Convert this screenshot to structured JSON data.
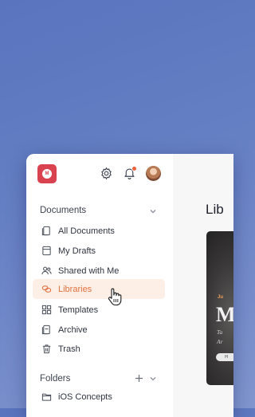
{
  "colors": {
    "accent": "#e2713f",
    "active_bg": "#fdeee6",
    "logo": "#d9434f",
    "notification_dot": "#f0623c"
  },
  "header": {
    "logo_mark": "M",
    "icons": [
      "gear-icon",
      "bell-icon",
      "avatar"
    ]
  },
  "documents_section": {
    "title": "Documents",
    "items": [
      {
        "label": "All Documents",
        "icon": "documents-icon"
      },
      {
        "label": "My Drafts",
        "icon": "drafts-icon"
      },
      {
        "label": "Shared with Me",
        "icon": "people-icon"
      },
      {
        "label": "Libraries",
        "icon": "libraries-icon",
        "active": true
      },
      {
        "label": "Templates",
        "icon": "templates-icon"
      },
      {
        "label": "Archive",
        "icon": "archive-icon"
      },
      {
        "label": "Trash",
        "icon": "trash-icon"
      }
    ]
  },
  "folders_section": {
    "title": "Folders",
    "items": [
      {
        "label": "iOS Concepts",
        "icon": "folder-icon"
      }
    ]
  },
  "main": {
    "title": "Lib",
    "card": {
      "tag": "Ju",
      "big": "M",
      "line1": "Ta",
      "line2": "Ar",
      "button": "H"
    }
  }
}
